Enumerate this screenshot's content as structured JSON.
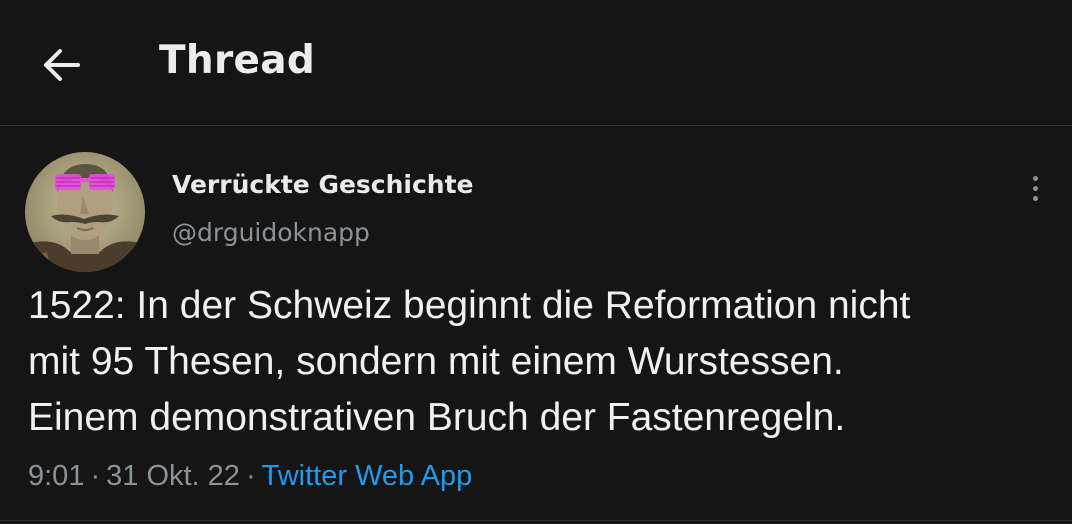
{
  "header": {
    "title": "Thread",
    "back_icon": "arrow-left-icon"
  },
  "tweet": {
    "author": {
      "display_name": "Verrückte Geschichte",
      "handle": "@drguidoknapp"
    },
    "text_lines": [
      "1522: In der Schweiz beginnt die Reformation nicht",
      "mit 95 Thesen, sondern mit einem Wurstessen.",
      "Einem demonstrativen Bruch der Fastenregeln."
    ],
    "time": "9:01",
    "date": "31 Okt. 22",
    "separator": "·",
    "source": "Twitter Web App",
    "more_icon": "more-vertical-icon"
  },
  "colors": {
    "background": "#151515",
    "text_primary": "#e9eaea",
    "text_secondary": "#8b9298",
    "link": "#1d9bf0",
    "divider": "#2f3336",
    "glasses_accent": "#e84ee0"
  }
}
